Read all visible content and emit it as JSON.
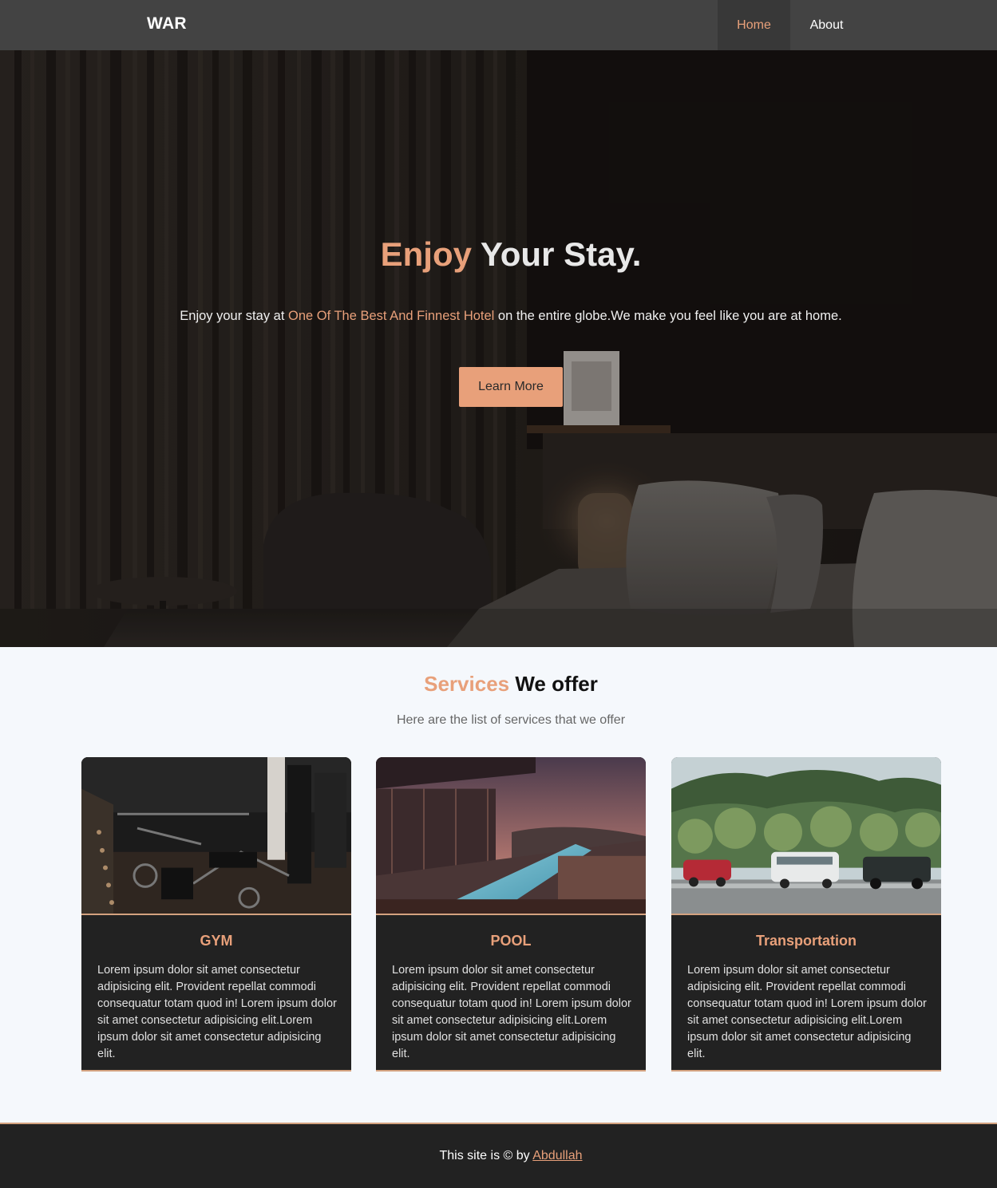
{
  "navbar": {
    "brand": "WAR",
    "links": [
      {
        "label": "Home",
        "active": true
      },
      {
        "label": "About",
        "active": false
      }
    ]
  },
  "hero": {
    "title_accent": "Enjoy",
    "title_rest": " Your Stay.",
    "text_before": "Enjoy your stay at ",
    "text_accent": "One Of The Best And Finnest Hotel",
    "text_after": " on the entire globe.We make you feel like you are at home.",
    "button_label": "Learn More"
  },
  "services": {
    "title_accent": "Services",
    "title_rest": " We offer",
    "subtitle": "Here are the list of services that we offer",
    "cards": [
      {
        "title": "GYM",
        "text": "Lorem ipsum dolor sit amet consectetur adipisicing elit. Provident repellat commodi consequatur totam quod in! Lorem ipsum dolor sit amet consectetur adipisicing elit.Lorem ipsum dolor sit amet consectetur adipisicing elit."
      },
      {
        "title": "POOL",
        "text": "Lorem ipsum dolor sit amet consectetur adipisicing elit. Provident repellat commodi consequatur totam quod in! Lorem ipsum dolor sit amet consectetur adipisicing elit.Lorem ipsum dolor sit amet consectetur adipisicing elit."
      },
      {
        "title": "Transportation",
        "text": "Lorem ipsum dolor sit amet consectetur adipisicing elit. Provident repellat commodi consequatur totam quod in! Lorem ipsum dolor sit amet consectetur adipisicing elit.Lorem ipsum dolor sit amet consectetur adipisicing elit."
      }
    ]
  },
  "footer": {
    "text": "This site is © by ",
    "link": "Abdullah"
  },
  "colors": {
    "accent": "#e8a07a",
    "nav_bg": "#434343",
    "card_bg": "#222222",
    "page_bg": "#f5f8fc"
  }
}
